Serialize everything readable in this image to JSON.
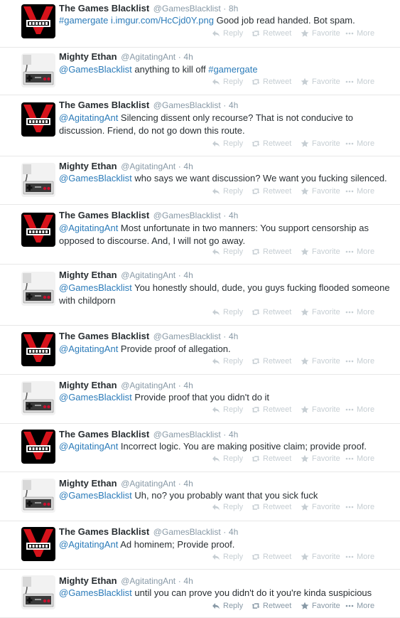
{
  "colors": {
    "name": "#292f33",
    "meta": "#8899a6",
    "link": "#2b7bb9",
    "action": "#c6ced3",
    "action_dark": "#8899a6",
    "divider": "#e8e8e8"
  },
  "icons": {
    "reply": "reply-icon",
    "retweet": "retweet-icon",
    "favorite": "star-icon",
    "more": "more-dots-icon"
  },
  "actions": {
    "reply": "Reply",
    "retweet": "Retweet",
    "favorite": "Favorite",
    "more": "More"
  },
  "tweets": [
    {
      "author": "blacklist",
      "name": "The Games Blacklist",
      "handle": "@GamesBlacklist",
      "sep": "·",
      "time": "8h",
      "parts": [
        {
          "t": "#gamergate i.imgur.com/HcCjd0Y.png",
          "link": true
        },
        {
          "t": " Good job read handed. Bot spam.",
          "link": false
        }
      ]
    },
    {
      "author": "ethan",
      "name": "Mighty Ethan",
      "handle": "@AgitatingAnt",
      "sep": "·",
      "time": "4h",
      "parts": [
        {
          "t": "@GamesBlacklist",
          "link": true
        },
        {
          "t": " anything to kill off ",
          "link": false
        },
        {
          "t": "#gamergate",
          "link": true
        }
      ]
    },
    {
      "author": "blacklist",
      "name": "The Games Blacklist",
      "handle": "@GamesBlacklist",
      "sep": "·",
      "time": "4h",
      "parts": [
        {
          "t": "@AgitatingAnt",
          "link": true
        },
        {
          "t": " Silencing dissent only recourse? That is not conducive to discussion. Friend, do not go down this route.",
          "link": false
        }
      ]
    },
    {
      "author": "ethan",
      "name": "Mighty Ethan",
      "handle": "@AgitatingAnt",
      "sep": "·",
      "time": "4h",
      "parts": [
        {
          "t": "@GamesBlacklist",
          "link": true
        },
        {
          "t": " who says we want discussion? We want you fucking silenced.",
          "link": false
        }
      ]
    },
    {
      "author": "blacklist",
      "name": "The Games Blacklist",
      "handle": "@GamesBlacklist",
      "sep": "·",
      "time": "4h",
      "parts": [
        {
          "t": "@AgitatingAnt",
          "link": true
        },
        {
          "t": " Most unfortunate in two manners: You support censorship as opposed to discourse. And, I will not go away.",
          "link": false
        }
      ]
    },
    {
      "author": "ethan",
      "name": "Mighty Ethan",
      "handle": "@AgitatingAnt",
      "sep": "·",
      "time": "4h",
      "parts": [
        {
          "t": "@GamesBlacklist",
          "link": true
        },
        {
          "t": " You honestly should, dude, you guys fucking flooded someone with childporn",
          "link": false
        }
      ]
    },
    {
      "author": "blacklist",
      "name": "The Games Blacklist",
      "handle": "@GamesBlacklist",
      "sep": "·",
      "time": "4h",
      "parts": [
        {
          "t": "@AgitatingAnt",
          "link": true
        },
        {
          "t": " Provide proof of allegation.",
          "link": false
        }
      ]
    },
    {
      "author": "ethan",
      "name": "Mighty Ethan",
      "handle": "@AgitatingAnt",
      "sep": "·",
      "time": "4h",
      "parts": [
        {
          "t": "@GamesBlacklist",
          "link": true
        },
        {
          "t": " Provide proof that you didn't do it",
          "link": false
        }
      ]
    },
    {
      "author": "blacklist",
      "name": "The Games Blacklist",
      "handle": "@GamesBlacklist",
      "sep": "·",
      "time": "4h",
      "parts": [
        {
          "t": "@AgitatingAnt",
          "link": true
        },
        {
          "t": " Incorrect logic. You are making positive claim; provide proof.",
          "link": false
        }
      ]
    },
    {
      "author": "ethan",
      "name": "Mighty Ethan",
      "handle": "@AgitatingAnt",
      "sep": "·",
      "time": "4h",
      "parts": [
        {
          "t": "@GamesBlacklist",
          "link": true
        },
        {
          "t": " Uh, no? you probably want that you sick fuck",
          "link": false
        }
      ]
    },
    {
      "author": "blacklist",
      "name": "The Games Blacklist",
      "handle": "@GamesBlacklist",
      "sep": "·",
      "time": "4h",
      "parts": [
        {
          "t": "@AgitatingAnt",
          "link": true
        },
        {
          "t": " Ad hominem; Provide proof.",
          "link": false
        }
      ]
    },
    {
      "author": "ethan",
      "name": "Mighty Ethan",
      "handle": "@AgitatingAnt",
      "sep": "·",
      "time": "4h",
      "parts": [
        {
          "t": "@GamesBlacklist",
          "link": true
        },
        {
          "t": " until you can prove you didn't do it you're kinda suspicious",
          "link": false
        }
      ]
    }
  ]
}
